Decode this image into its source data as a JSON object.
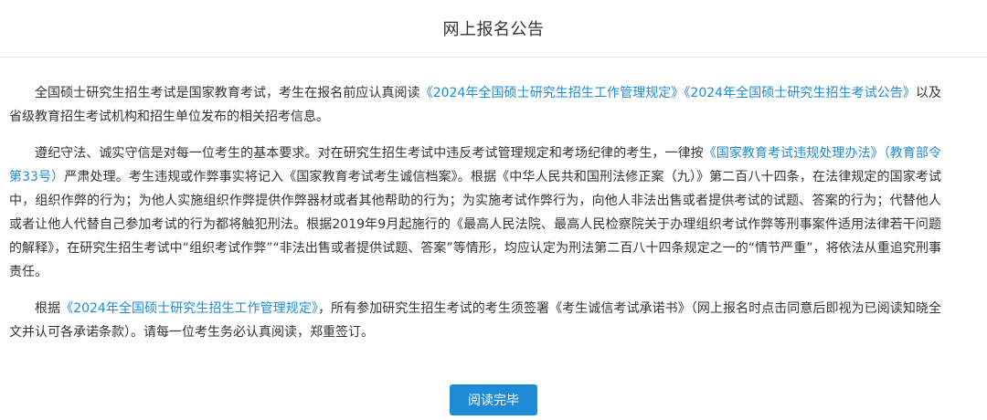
{
  "header": {
    "title": "网上报名公告"
  },
  "paragraphs": {
    "p1": {
      "s1": "全国硕士研究生招生考试是国家教育考试，考生在报名前应认真阅读",
      "link1": "《2024年全国硕士研究生招生工作管理规定》",
      "link2": "《2024年全国硕士研究生招生考试公告》",
      "s2": "以及省级教育招生考试机构和招生单位发布的相关招考信息。"
    },
    "p2": {
      "s1": "遵纪守法、诚实守信是对每一位考生的基本要求。对在研究生招生考试中违反考试管理规定和考场纪律的考生，一律按",
      "link1": "《国家教育考试违规处理办法》（教育部令第33号）",
      "s2": "严肃处理。考生违规或作弊事实将记入《国家教育考试考生诚信档案》。根据《中华人民共和国刑法修正案（九）》第二百八十四条，在法律规定的国家考试中，组织作弊的行为；为他人实施组织作弊提供作弊器材或者其他帮助的行为；为实施考试作弊行为，向他人非法出售或者提供考试的试题、答案的行为；代替他人或者让他人代替自己参加考试的行为都将触犯刑法。根据2019年9月起施行的《最高人民法院、最高人民检察院关于办理组织考试作弊等刑事案件适用法律若干问题的解释》，在研究生招生考试中“组织考试作弊”“非法出售或者提供试题、答案”等情形，均应认定为刑法第二百八十四条规定之一的“情节严重”，将依法从重追究刑事责任。"
    },
    "p3": {
      "s1": "根据",
      "link1": "《2024年全国硕士研究生招生工作管理规定》",
      "s2": "，所有参加研究生招生考试的考生须签署《考生诚信考试承诺书》（网上报名时点击同意后即视为已阅读知晓全文并认可各承诺条款）。请每一位考生务必认真阅读，郑重签订。"
    }
  },
  "footer": {
    "confirm_label": "阅读完毕"
  },
  "colors": {
    "link": "#1e8bd6",
    "button_bg": "#1e8bd6",
    "text": "#333333",
    "divider": "#e6e6e6"
  }
}
